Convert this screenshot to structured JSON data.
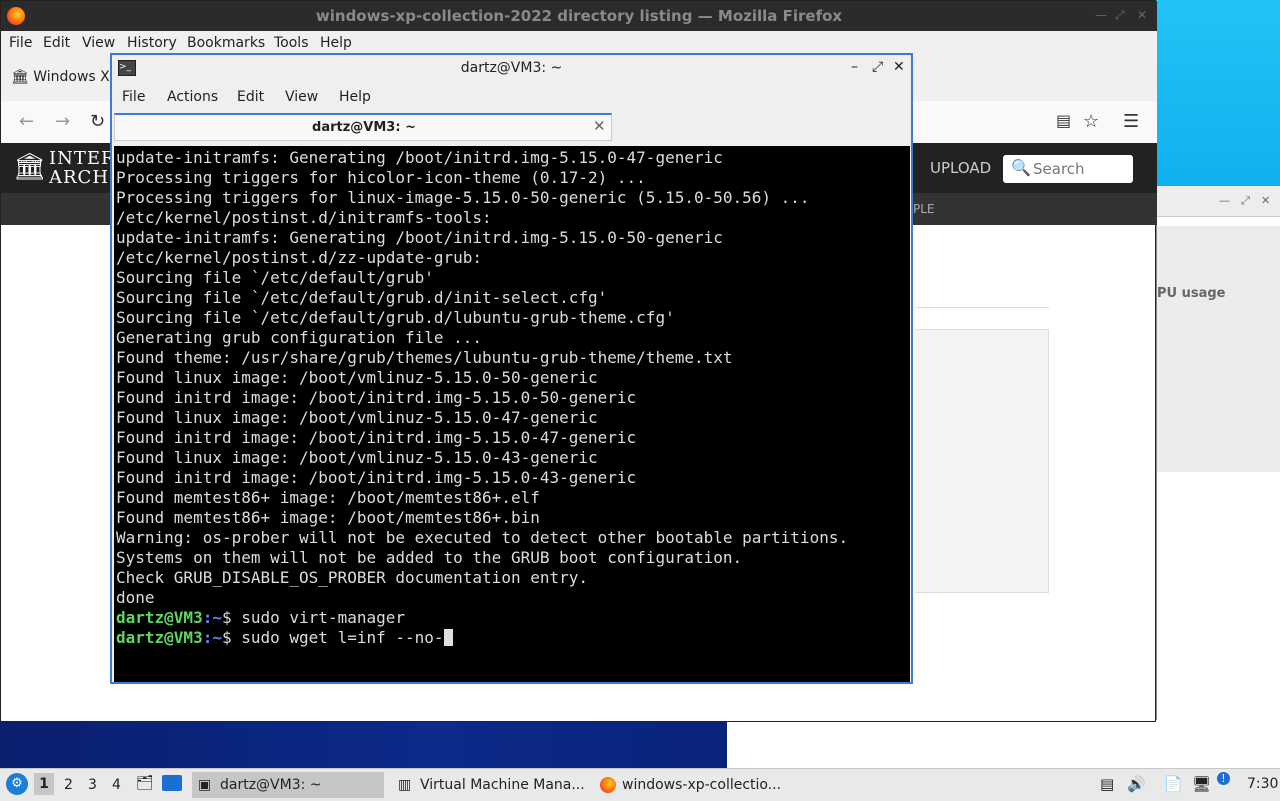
{
  "desktop": {
    "colors": {
      "wallpaper": "#0a1f6e",
      "accent": "#3a7bd5"
    }
  },
  "firefox": {
    "title": "windows-xp-collection-2022 directory listing — Mozilla Firefox",
    "menu": [
      "File",
      "Edit",
      "View",
      "History",
      "Bookmarks",
      "Tools",
      "Help"
    ],
    "tab_label": "Windows XP",
    "site": {
      "logo_line1": "INTER",
      "logo_line2": "ARCHIV",
      "upload_label": "UPLOAD",
      "search_placeholder": "Search",
      "sub_nav_fragment": "PLE"
    }
  },
  "vm_manager": {
    "column_fragment": "PU usage"
  },
  "terminal": {
    "title": "dartz@VM3: ~",
    "menu": [
      "File",
      "Actions",
      "Edit",
      "View",
      "Help"
    ],
    "tab_label": "dartz@VM3: ~",
    "output_lines": [
      "update-initramfs: Generating /boot/initrd.img-5.15.0-47-generic",
      "Processing triggers for hicolor-icon-theme (0.17-2) ...",
      "Processing triggers for linux-image-5.15.0-50-generic (5.15.0-50.56) ...",
      "/etc/kernel/postinst.d/initramfs-tools:",
      "update-initramfs: Generating /boot/initrd.img-5.15.0-50-generic",
      "/etc/kernel/postinst.d/zz-update-grub:",
      "Sourcing file `/etc/default/grub'",
      "Sourcing file `/etc/default/grub.d/init-select.cfg'",
      "Sourcing file `/etc/default/grub.d/lubuntu-grub-theme.cfg'",
      "Generating grub configuration file ...",
      "Found theme: /usr/share/grub/themes/lubuntu-grub-theme/theme.txt",
      "Found linux image: /boot/vmlinuz-5.15.0-50-generic",
      "Found initrd image: /boot/initrd.img-5.15.0-50-generic",
      "Found linux image: /boot/vmlinuz-5.15.0-47-generic",
      "Found initrd image: /boot/initrd.img-5.15.0-47-generic",
      "Found linux image: /boot/vmlinuz-5.15.0-43-generic",
      "Found initrd image: /boot/initrd.img-5.15.0-43-generic",
      "Found memtest86+ image: /boot/memtest86+.elf",
      "Found memtest86+ image: /boot/memtest86+.bin",
      "Warning: os-prober will not be executed to detect other bootable partitions.",
      "Systems on them will not be added to the GRUB boot configuration.",
      "Check GRUB_DISABLE_OS_PROBER documentation entry.",
      "done"
    ],
    "prompt_user": "dartz@VM3",
    "prompt_path": ":~",
    "prompt_symbol": "$",
    "commands": [
      " sudo virt-manager",
      " sudo wget l=inf --no-"
    ]
  },
  "taskbar": {
    "workspaces": [
      "1",
      "2",
      "3",
      "4"
    ],
    "tasks": [
      {
        "label": "dartz@VM3: ~",
        "icon": "terminal-icon"
      },
      {
        "label": "Virtual Machine Mana...",
        "icon": "virt-manager-icon"
      },
      {
        "label": "windows-xp-collectio...",
        "icon": "firefox-icon"
      }
    ],
    "clock": "7:30"
  }
}
